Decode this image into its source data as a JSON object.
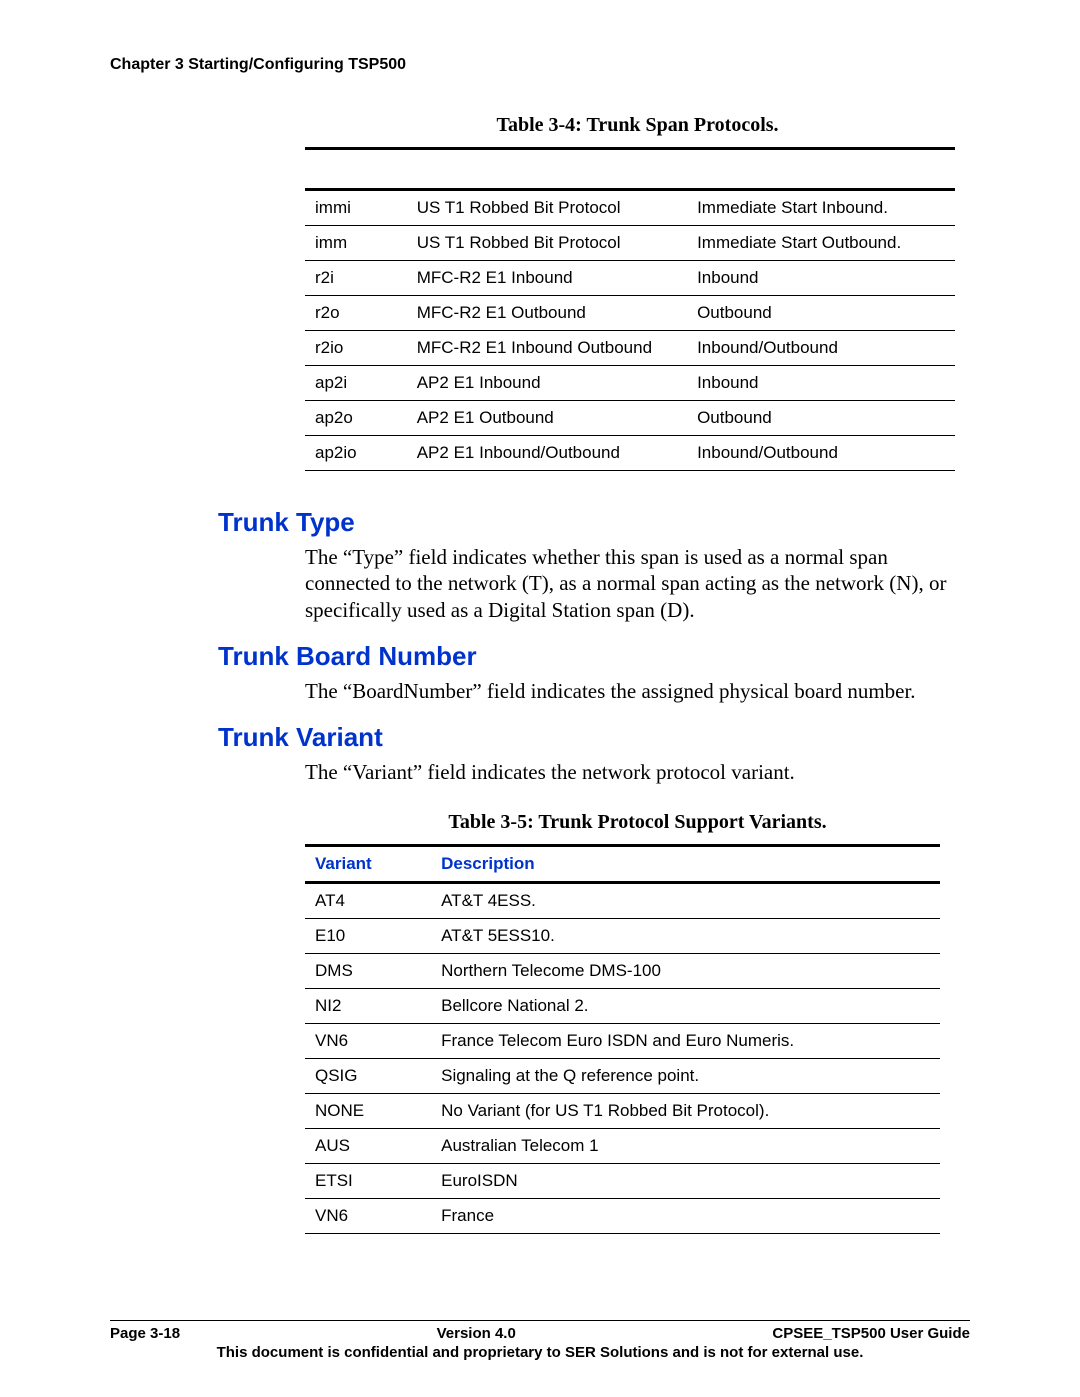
{
  "header": "Chapter 3 Starting/Configuring TSP500",
  "table1": {
    "caption": "Table 3-4: Trunk Span Protocols.",
    "rows": [
      {
        "code": "immi",
        "protocol": "US T1 Robbed Bit Protocol",
        "desc": "Immediate Start Inbound."
      },
      {
        "code": "imm",
        "protocol": "US T1 Robbed Bit Protocol",
        "desc": "Immediate Start Outbound."
      },
      {
        "code": "r2i",
        "protocol": "MFC-R2  E1 Inbound",
        "desc": "Inbound"
      },
      {
        "code": "r2o",
        "protocol": "MFC-R2  E1 Outbound",
        "desc": "Outbound"
      },
      {
        "code": "r2io",
        "protocol": "MFC-R2  E1 Inbound Outbound",
        "desc": "Inbound/Outbound"
      },
      {
        "code": "ap2i",
        "protocol": "AP2 E1 Inbound",
        "desc": "Inbound"
      },
      {
        "code": "ap2o",
        "protocol": "AP2 E1 Outbound",
        "desc": "Outbound"
      },
      {
        "code": "ap2io",
        "protocol": "AP2 E1 Inbound/Outbound",
        "desc": "Inbound/Outbound"
      }
    ]
  },
  "sections": {
    "trunk_type": {
      "title": "Trunk Type",
      "body": "The “Type” field indicates whether this span is used as a normal span connected to the network (T), as a normal span acting as the network (N), or specifically used as a Digital Station span (D)."
    },
    "trunk_board_number": {
      "title": "Trunk Board Number",
      "body": "The “BoardNumber” field indicates the assigned physical board number."
    },
    "trunk_variant": {
      "title": "Trunk Variant",
      "body": "The “Variant” field indicates the network protocol variant."
    }
  },
  "table2": {
    "caption": "Table 3-5: Trunk Protocol Support Variants.",
    "headers": {
      "c0": "Variant",
      "c1": "Description"
    },
    "rows": [
      {
        "variant": "AT4",
        "desc": "AT&T 4ESS."
      },
      {
        "variant": "E10",
        "desc": "AT&T 5ESS10."
      },
      {
        "variant": "DMS",
        "desc": "Northern Telecome DMS-100"
      },
      {
        "variant": "NI2",
        "desc": "Bellcore National 2."
      },
      {
        "variant": "VN6",
        "desc": "France Telecom Euro ISDN and Euro Numeris."
      },
      {
        "variant": "QSIG",
        "desc": "Signaling at the Q reference point."
      },
      {
        "variant": "NONE",
        "desc": "No Variant (for US T1 Robbed Bit Protocol)."
      },
      {
        "variant": "AUS",
        "desc": "Australian Telecom 1"
      },
      {
        "variant": "ETSI",
        "desc": "EuroISDN"
      },
      {
        "variant": "VN6",
        "desc": "France"
      }
    ]
  },
  "footer": {
    "page": "Page 3-18",
    "version": "Version 4.0",
    "doc": "CPSEE_TSP500 User Guide",
    "note": "This document is confidential and proprietary to SER Solutions and is not for external use."
  }
}
